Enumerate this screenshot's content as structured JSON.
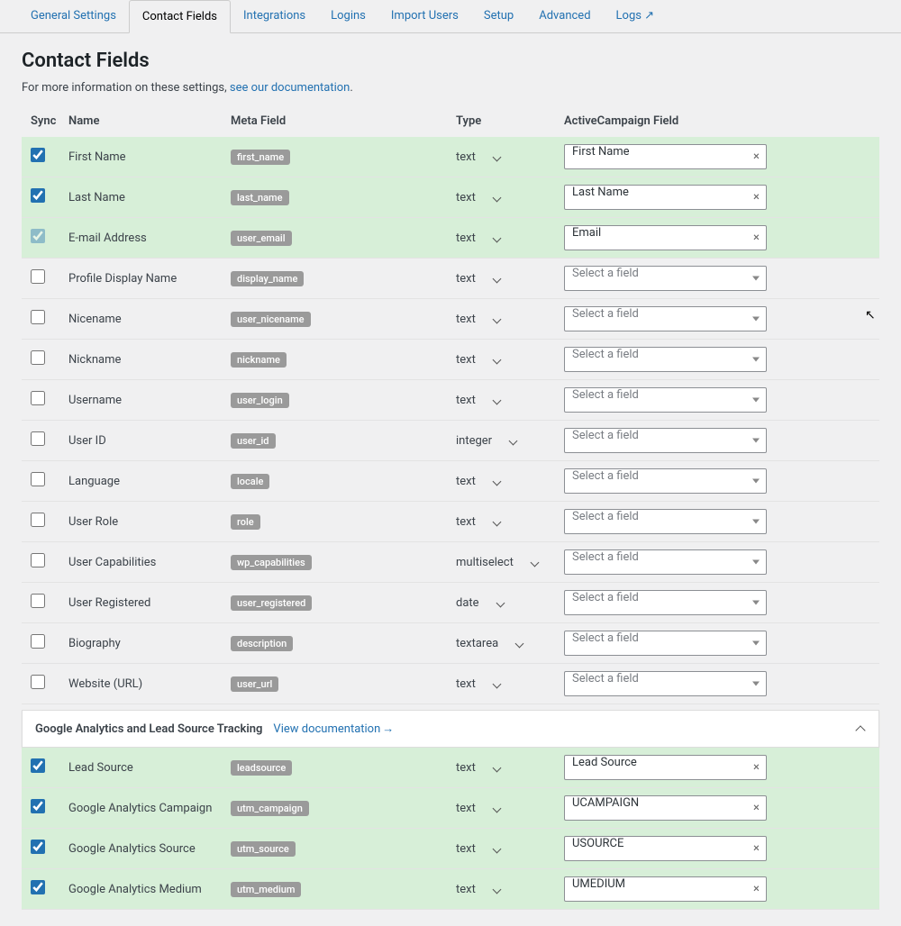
{
  "tabs": [
    {
      "label": "General Settings",
      "active": false
    },
    {
      "label": "Contact Fields",
      "active": true
    },
    {
      "label": "Integrations",
      "active": false
    },
    {
      "label": "Logins",
      "active": false
    },
    {
      "label": "Import Users",
      "active": false
    },
    {
      "label": "Setup",
      "active": false
    },
    {
      "label": "Advanced",
      "active": false
    },
    {
      "label": "Logs ↗",
      "active": false
    }
  ],
  "page": {
    "title": "Contact Fields",
    "intro_prefix": "For more information on these settings, ",
    "intro_link": "see our documentation",
    "intro_suffix": "."
  },
  "columns": {
    "sync": "Sync",
    "name": "Name",
    "meta": "Meta Field",
    "type": "Type",
    "crm": "ActiveCampaign Field"
  },
  "placeholder": "Select a field",
  "rows": [
    {
      "checked": true,
      "locked": false,
      "name": "First Name",
      "meta": "first_name",
      "type": "text",
      "field": "First Name"
    },
    {
      "checked": true,
      "locked": false,
      "name": "Last Name",
      "meta": "last_name",
      "type": "text",
      "field": "Last Name"
    },
    {
      "checked": true,
      "locked": true,
      "name": "E-mail Address",
      "meta": "user_email",
      "type": "text",
      "field": "Email"
    },
    {
      "checked": false,
      "locked": false,
      "name": "Profile Display Name",
      "meta": "display_name",
      "type": "text",
      "field": ""
    },
    {
      "checked": false,
      "locked": false,
      "name": "Nicename",
      "meta": "user_nicename",
      "type": "text",
      "field": ""
    },
    {
      "checked": false,
      "locked": false,
      "name": "Nickname",
      "meta": "nickname",
      "type": "text",
      "field": ""
    },
    {
      "checked": false,
      "locked": false,
      "name": "Username",
      "meta": "user_login",
      "type": "text",
      "field": ""
    },
    {
      "checked": false,
      "locked": false,
      "name": "User ID",
      "meta": "user_id",
      "type": "integer",
      "field": ""
    },
    {
      "checked": false,
      "locked": false,
      "name": "Language",
      "meta": "locale",
      "type": "text",
      "field": ""
    },
    {
      "checked": false,
      "locked": false,
      "name": "User Role",
      "meta": "role",
      "type": "text",
      "field": ""
    },
    {
      "checked": false,
      "locked": false,
      "name": "User Capabilities",
      "meta": "wp_capabilities",
      "type": "multiselect",
      "field": ""
    },
    {
      "checked": false,
      "locked": false,
      "name": "User Registered",
      "meta": "user_registered",
      "type": "date",
      "field": ""
    },
    {
      "checked": false,
      "locked": false,
      "name": "Biography",
      "meta": "description",
      "type": "textarea",
      "field": ""
    },
    {
      "checked": false,
      "locked": false,
      "name": "Website (URL)",
      "meta": "user_url",
      "type": "text",
      "field": ""
    }
  ],
  "section": {
    "title": "Google Analytics and Lead Source Tracking",
    "link": "View documentation"
  },
  "section_rows": [
    {
      "checked": true,
      "name": "Lead Source",
      "meta": "leadsource",
      "type": "text",
      "field": "Lead Source"
    },
    {
      "checked": true,
      "name": "Google Analytics Campaign",
      "meta": "utm_campaign",
      "type": "text",
      "field": "UCAMPAIGN"
    },
    {
      "checked": true,
      "name": "Google Analytics Source",
      "meta": "utm_source",
      "type": "text",
      "field": "USOURCE"
    },
    {
      "checked": true,
      "name": "Google Analytics Medium",
      "meta": "utm_medium",
      "type": "text",
      "field": "UMEDIUM"
    }
  ]
}
